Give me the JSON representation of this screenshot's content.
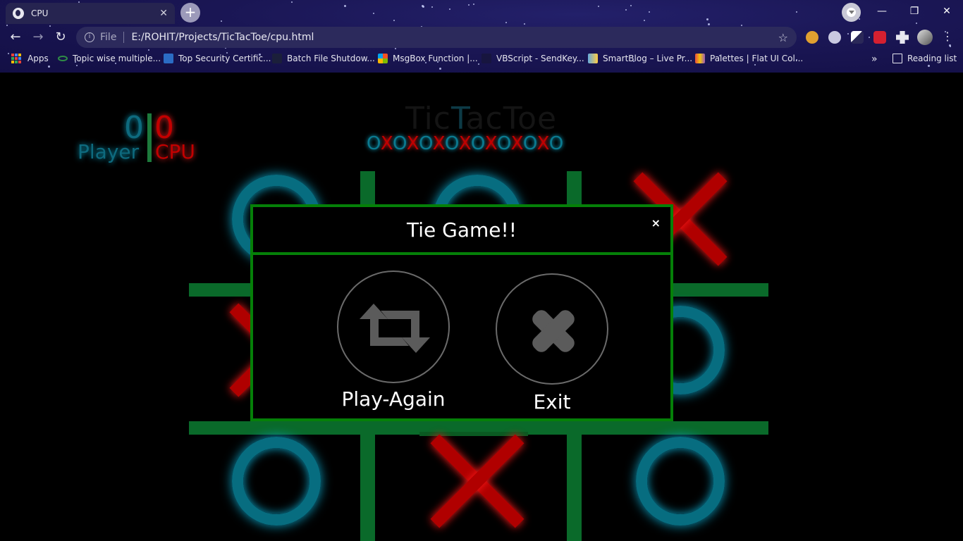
{
  "browser": {
    "tab_title": "CPU",
    "tab_close": "✕",
    "new_tab": "+",
    "window_controls": {
      "minimize": "—",
      "restore": "❐",
      "close": "✕"
    },
    "nav": {
      "back": "←",
      "forward": "→",
      "reload": "↻"
    },
    "address": {
      "scheme": "File",
      "url": "E:/ROHIT/Projects/TicTacToe/cpu.html",
      "bookmark_star": "☆"
    },
    "bookmarks": [
      {
        "label": "Apps"
      },
      {
        "label": "Topic wise multiple..."
      },
      {
        "label": "Top Security Certific..."
      },
      {
        "label": "Batch File Shutdow..."
      },
      {
        "label": "MsgBox Function |..."
      },
      {
        "label": "VBScript - SendKey..."
      },
      {
        "label": "SmartBlog – Live Pr..."
      },
      {
        "label": "Palettes | Flat UI Col..."
      }
    ],
    "bookmarks_overflow": "»",
    "reading_list": "Reading list",
    "menu": "⋮"
  },
  "game": {
    "score": {
      "player": "0",
      "cpu": "0",
      "player_label": "Player",
      "cpu_label": "CPU"
    },
    "title_left": "Tic",
    "title_mid": "T",
    "title_right": "acToe",
    "marks_sequence": [
      "O",
      "X",
      "O",
      "X",
      "O",
      "X",
      "O",
      "X",
      "O",
      "X",
      "O",
      "X",
      "O",
      "X",
      "O"
    ],
    "board": [
      "O",
      "O",
      "X",
      "X",
      "",
      "O",
      "O",
      "X",
      "O"
    ]
  },
  "modal": {
    "title": "Tie Game!!",
    "close": "×",
    "play_again_label": "Play-Again",
    "exit_label": "Exit"
  },
  "colors": {
    "accent_green": "#058008",
    "o_color": "#076d80",
    "x_color": "#b00000"
  }
}
